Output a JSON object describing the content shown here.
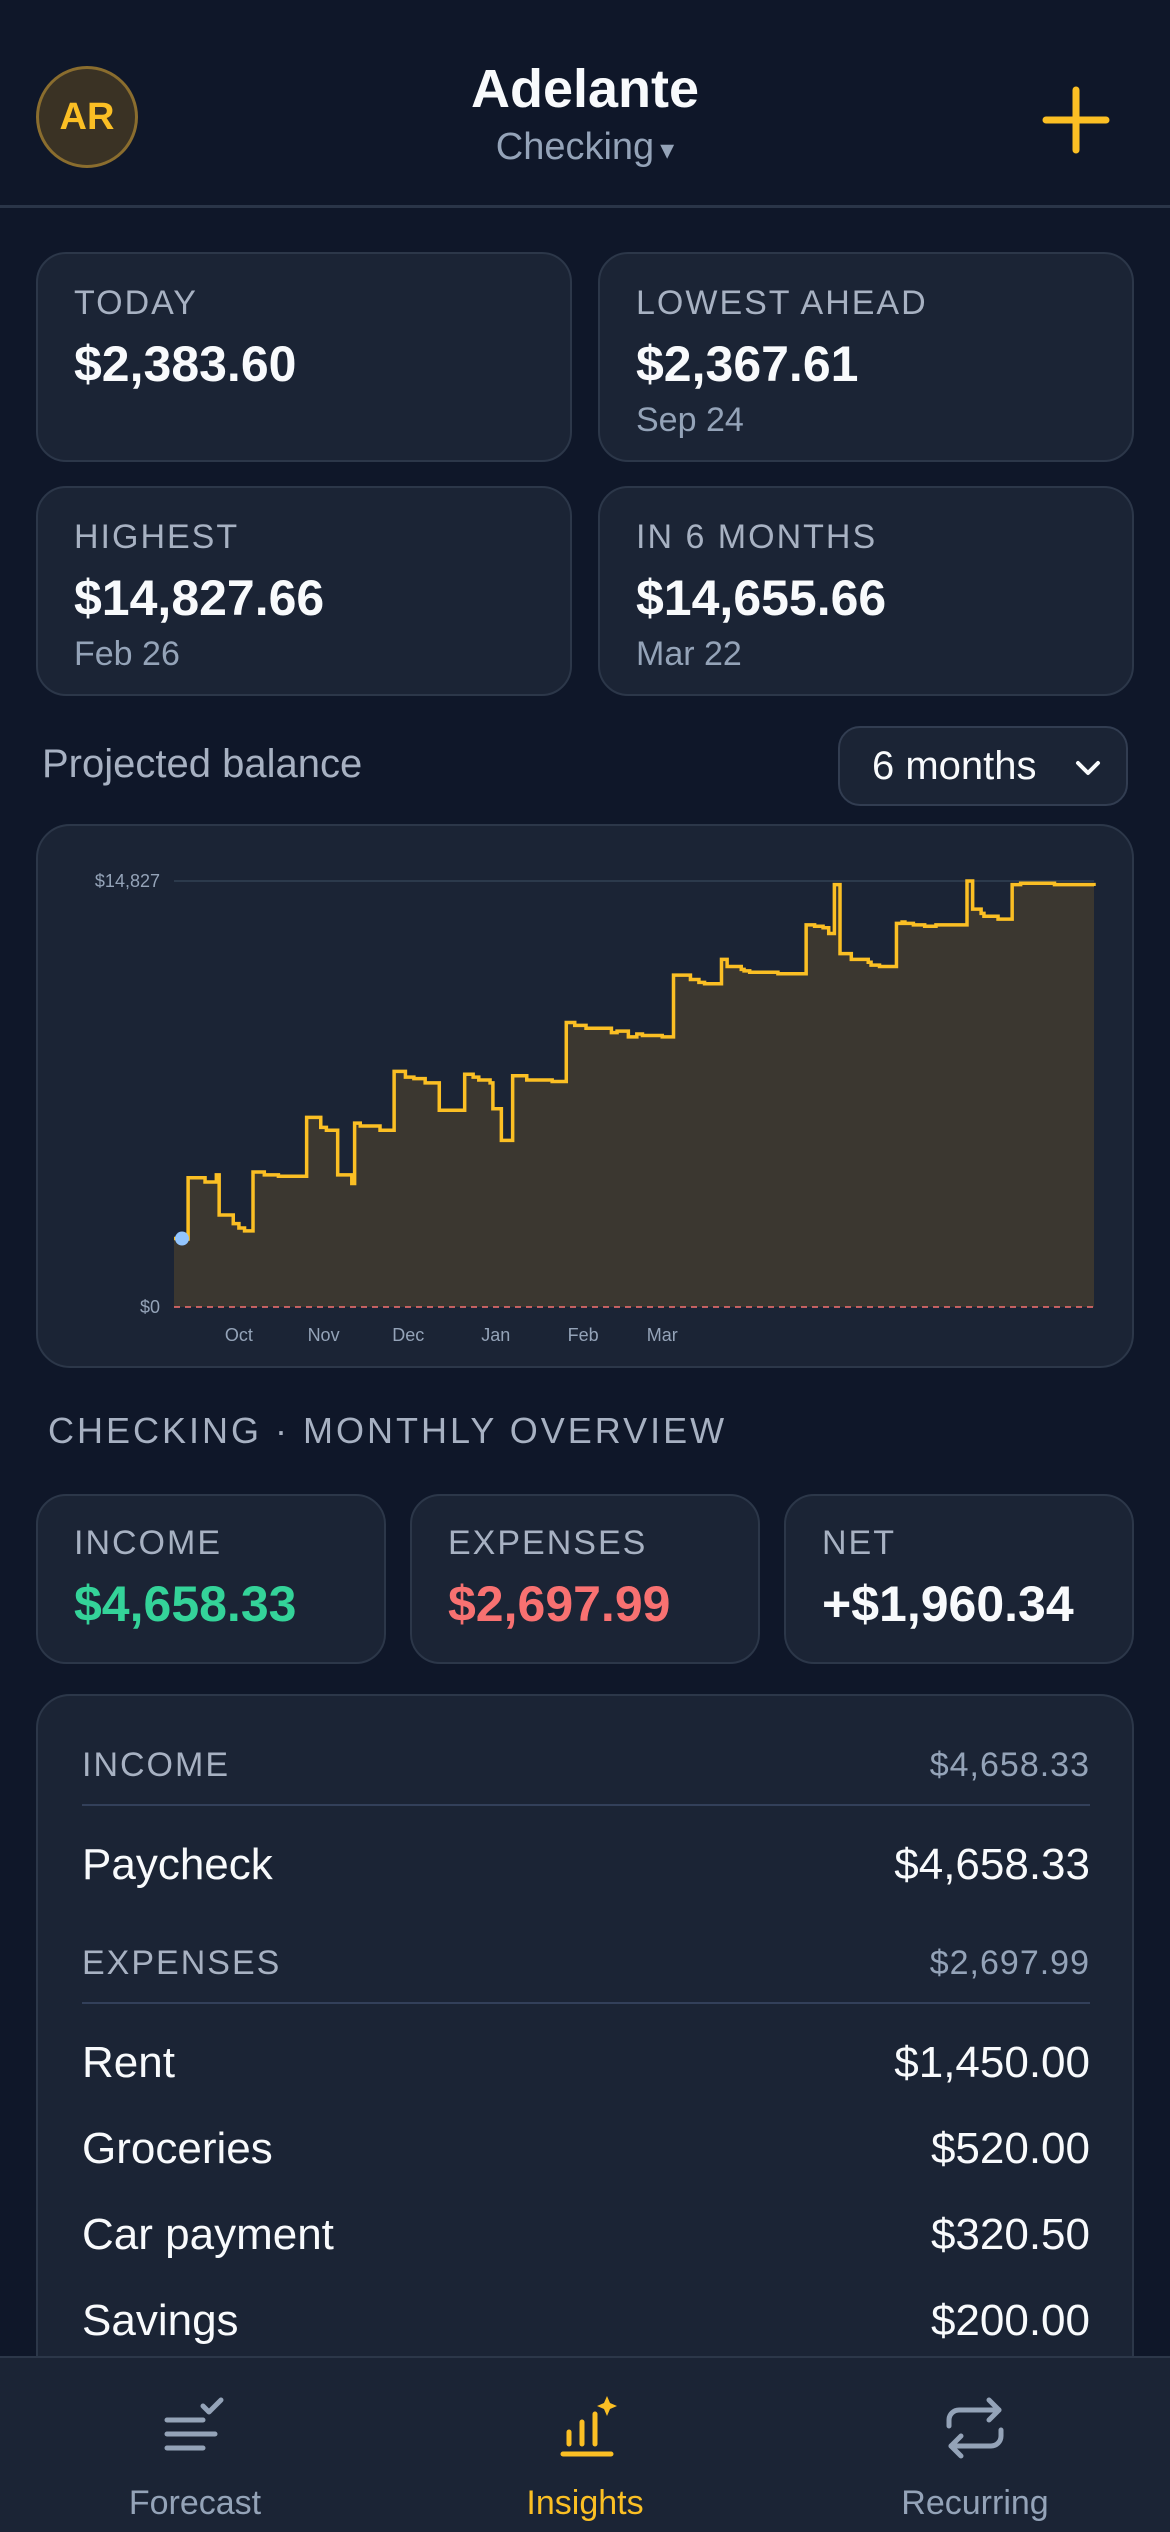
{
  "header": {
    "avatar_initials": "AR",
    "title": "Adelante",
    "account": "Checking"
  },
  "stats": [
    {
      "label": "TODAY",
      "value": "$2,383.60",
      "sub": ""
    },
    {
      "label": "LOWEST AHEAD",
      "value": "$2,367.61",
      "sub": "Sep 24"
    },
    {
      "label": "HIGHEST",
      "value": "$14,827.66",
      "sub": "Feb 26"
    },
    {
      "label": "IN 6 MONTHS",
      "value": "$14,655.66",
      "sub": "Mar 22"
    }
  ],
  "projection": {
    "label": "Projected balance",
    "range": "6 months"
  },
  "chart_data": {
    "type": "area",
    "y_tick_labels": [
      "$14,827",
      "$0"
    ],
    "x_tick_labels": [
      "Oct",
      "Nov",
      "Dec",
      "Jan",
      "Feb",
      "Mar"
    ],
    "ylim": [
      0,
      14827
    ],
    "x": [
      0,
      4,
      5,
      11,
      15,
      16,
      21,
      23,
      25,
      28,
      32,
      37,
      47,
      52,
      54,
      58,
      63,
      64,
      66,
      73,
      78,
      82,
      85,
      89,
      94,
      103,
      106,
      108,
      112,
      113,
      116,
      120,
      125,
      134,
      139,
      142,
      146,
      155,
      157,
      161,
      164,
      166,
      173,
      177,
      183,
      186,
      188,
      194,
      196,
      201,
      202,
      204,
      214,
      224,
      227,
      230,
      232,
      234,
      236,
      240,
      246,
      247,
      250,
      256,
      258,
      259,
      262,
      266,
      270,
      275,
      281,
      283,
      286,
      287,
      292,
      297,
      300,
      312,
      326
    ],
    "y": [
      2383,
      2367,
      4500,
      4350,
      4600,
      3200,
      2900,
      2750,
      2650,
      4700,
      4600,
      4550,
      6600,
      6250,
      6150,
      4600,
      4300,
      6400,
      6300,
      6150,
      8200,
      8000,
      7950,
      7800,
      6850,
      8100,
      8000,
      7900,
      7800,
      6900,
      5800,
      8050,
      7900,
      7850,
      9900,
      9800,
      9700,
      9550,
      9600,
      9400,
      9500,
      9450,
      9400,
      11550,
      11400,
      11300,
      11250,
      12100,
      11850,
      11750,
      11700,
      11650,
      11600,
      13300,
      13250,
      13200,
      13000,
      14700,
      12300,
      12100,
      12000,
      11900,
      11850,
      13350,
      13400,
      13350,
      13300,
      13250,
      13300,
      13300,
      14827,
      13850,
      13700,
      13600,
      13500,
      14700,
      14750,
      14700,
      14655
    ],
    "today_marker": {
      "x": 0,
      "y": 2383
    },
    "zero_line": true
  },
  "overview": {
    "title": "CHECKING · MONTHLY OVERVIEW",
    "income": {
      "label": "INCOME",
      "value": "$4,658.33"
    },
    "expenses": {
      "label": "EXPENSES",
      "value": "$2,697.99"
    },
    "net": {
      "label": "NET",
      "value": "+$1,960.34"
    }
  },
  "breakdown": {
    "income_header": {
      "label": "INCOME",
      "total": "$4,658.33"
    },
    "income_items": [
      {
        "name": "Paycheck",
        "amount": "$4,658.33"
      }
    ],
    "expenses_header": {
      "label": "EXPENSES",
      "total": "$2,697.99"
    },
    "expense_items": [
      {
        "name": "Rent",
        "amount": "$1,450.00"
      },
      {
        "name": "Groceries",
        "amount": "$520.00"
      },
      {
        "name": "Car payment",
        "amount": "$320.50"
      },
      {
        "name": "Savings",
        "amount": "$200.00"
      }
    ]
  },
  "tabs": [
    {
      "label": "Forecast",
      "icon": "list-check-icon",
      "active": false
    },
    {
      "label": "Insights",
      "icon": "bar-chart-sparkle-icon",
      "active": true
    },
    {
      "label": "Recurring",
      "icon": "repeat-icon",
      "active": false
    }
  ],
  "colors": {
    "accent": "#fbbf24",
    "income": "#34d399",
    "expense": "#f87171",
    "marker": "#93c5fd"
  }
}
